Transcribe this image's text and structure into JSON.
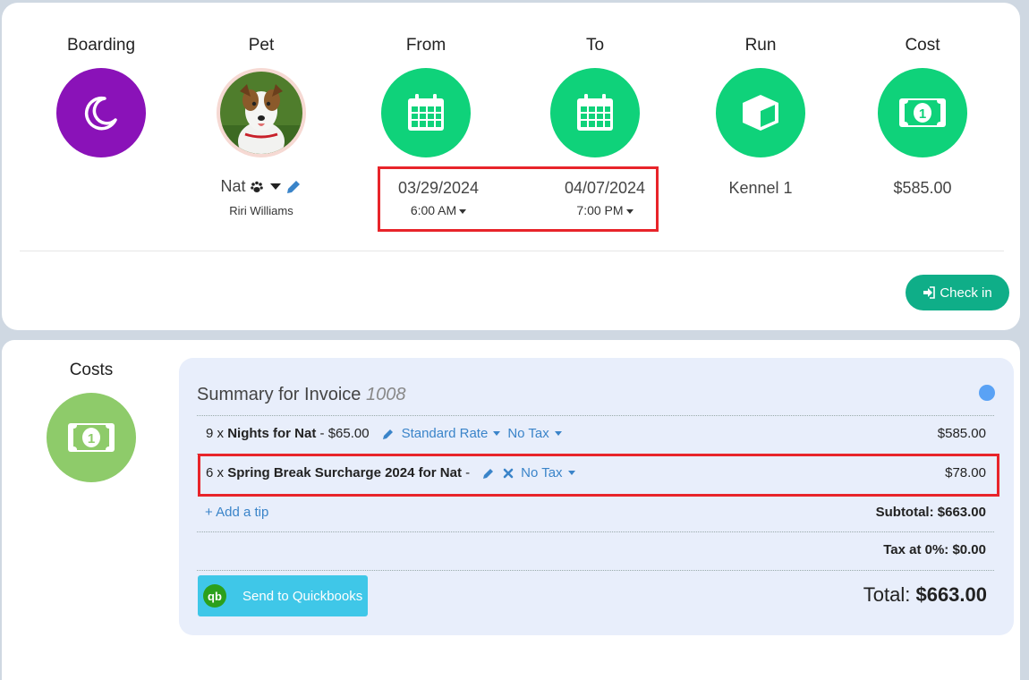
{
  "columns": {
    "boarding": {
      "title": "Boarding",
      "icon": "moon-icon",
      "color": "#8a12b8"
    },
    "pet": {
      "title": "Pet",
      "name": "Nat",
      "owner": "Riri Williams"
    },
    "from": {
      "title": "From",
      "icon": "calendar-icon",
      "date": "03/29/2024",
      "time": "6:00 AM"
    },
    "to": {
      "title": "To",
      "icon": "calendar-icon",
      "date": "04/07/2024",
      "time": "7:00 PM"
    },
    "run": {
      "title": "Run",
      "icon": "cube-icon",
      "value": "Kennel 1"
    },
    "cost": {
      "title": "Cost",
      "icon": "money-icon",
      "value": "$585.00"
    }
  },
  "checkin_button": {
    "label": "Check in",
    "color": "#0fae88"
  },
  "costs": {
    "title": "Costs",
    "icon": "money-icon"
  },
  "invoice": {
    "title_prefix": "Summary for Invoice",
    "number": "1008",
    "rows": [
      {
        "qty": "9 x",
        "item": "Nights for Nat",
        "price": "- $65.00",
        "rate": "Standard Rate",
        "tax": "No Tax",
        "amount": "$585.00"
      },
      {
        "qty": "6 x",
        "item": "Spring Break Surcharge 2024 for Nat",
        "price": "-",
        "tax": "No Tax",
        "amount": "$78.00"
      }
    ],
    "add_tip": "+ Add a tip",
    "subtotal": "Subtotal: $663.00",
    "tax": "Tax at 0%: $0.00",
    "total_label": "Total:",
    "total_value": "$663.00",
    "quickbooks_button": "Send to Quickbooks",
    "quickbooks_logo": "qb"
  },
  "colors": {
    "highlight": "#e8242a",
    "green": "#0fd27a",
    "accent_blue": "#3a84c9"
  }
}
